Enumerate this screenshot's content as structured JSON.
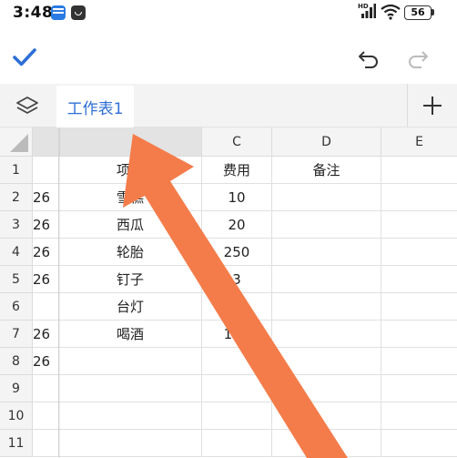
{
  "status_bar": {
    "time": "3:48",
    "network_label": "HD",
    "battery": "56"
  },
  "toolbar": {
    "confirm_icon": "check-icon",
    "undo_icon": "undo-icon",
    "redo_icon": "redo-icon",
    "accent_color": "#2f6fd6"
  },
  "tabs": {
    "layers_icon": "layers-icon",
    "sheets": [
      {
        "label": "工作表1",
        "active": true
      }
    ],
    "add_icon": "plus-icon"
  },
  "grid": {
    "columns": [
      "",
      "C",
      "D",
      "E"
    ],
    "rows": [
      {
        "num": "1",
        "a": "",
        "b": "项目",
        "c": "费用",
        "d": "备注"
      },
      {
        "num": "2",
        "a": "26",
        "b": "雪糕",
        "c": "10",
        "d": ""
      },
      {
        "num": "3",
        "a": "26",
        "b": "西瓜",
        "c": "20",
        "d": ""
      },
      {
        "num": "4",
        "a": "26",
        "b": "轮胎",
        "c": "250",
        "d": ""
      },
      {
        "num": "5",
        "a": "26",
        "b": "钉子",
        "c": "3",
        "d": ""
      },
      {
        "num": "6",
        "a": "",
        "b": "台灯",
        "c": "",
        "d": ""
      },
      {
        "num": "7",
        "a": "26",
        "b": "喝酒",
        "c": "100",
        "d": ""
      },
      {
        "num": "8",
        "a": "26",
        "b": "",
        "c": "",
        "d": ""
      },
      {
        "num": "9",
        "a": "",
        "b": "",
        "c": "",
        "d": ""
      },
      {
        "num": "10",
        "a": "",
        "b": "",
        "c": "",
        "d": ""
      },
      {
        "num": "11",
        "a": "",
        "b": "",
        "c": "",
        "d": ""
      }
    ]
  },
  "annotation": {
    "arrow_color": "#f47c4a"
  }
}
